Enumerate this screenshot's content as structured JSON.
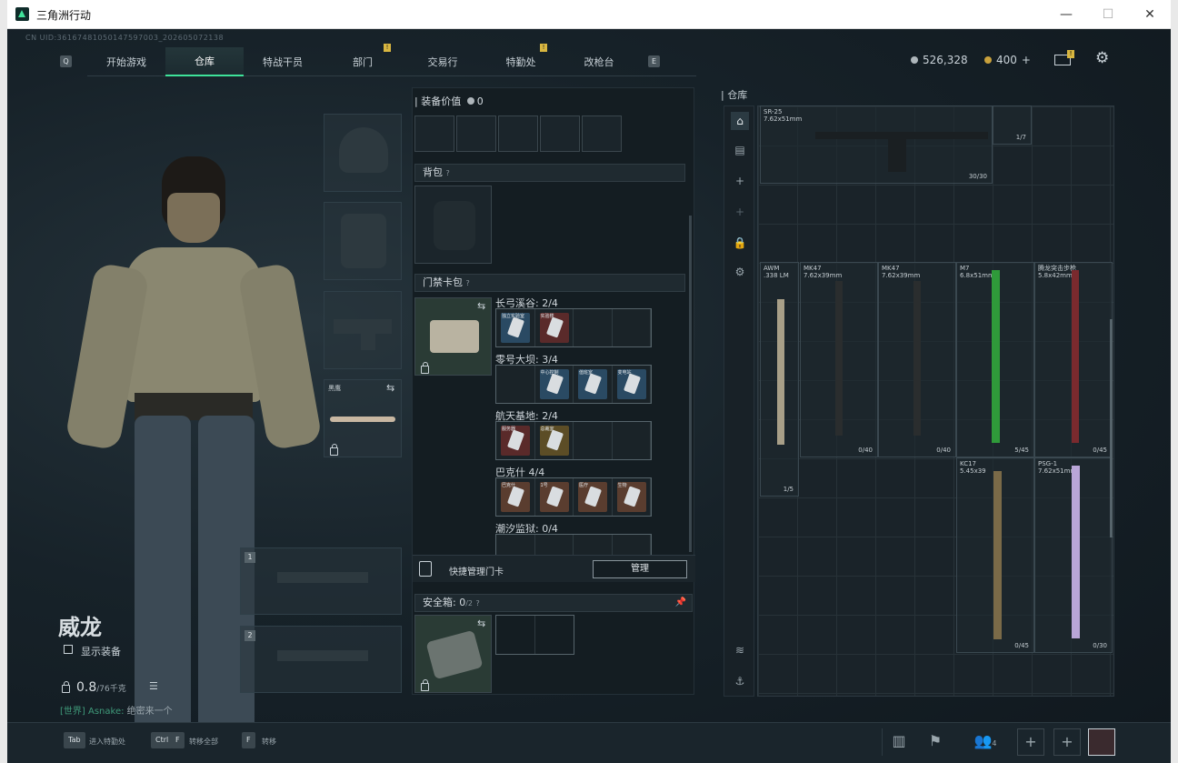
{
  "window": {
    "title": "三角洲行动"
  },
  "header": {
    "uid": "CN UID:3616748105014759700​3_202605072138",
    "tabs": [
      {
        "label": "开始游戏",
        "badge": ""
      },
      {
        "label": "仓库",
        "badge": ""
      },
      {
        "label": "特战干员",
        "badge": ""
      },
      {
        "label": "部门",
        "badge": "!"
      },
      {
        "label": "交易行",
        "badge": ""
      },
      {
        "label": "特勤处",
        "badge": "!"
      },
      {
        "label": "改枪台",
        "badge": ""
      }
    ],
    "key_left": "Q",
    "key_right": "E",
    "silver": "526,328",
    "gold": "400",
    "gold_plus": "+",
    "mail_badge": "!"
  },
  "character": {
    "name": "威龙",
    "show_gear_label": "显示装备",
    "weight": "0.8",
    "weight_max": "/76千克",
    "chat_channel": "[世界]",
    "chat_user": "Asnake:",
    "chat_msg": "绝密来一个",
    "weapon_slot_1": "1",
    "weapon_slot_2": "2",
    "melee_label": "黑鹰"
  },
  "middle": {
    "equip_value_label": "装备价值",
    "equip_value": "0",
    "backpack_label": "背包",
    "help": "?",
    "keycard_label": "门禁卡包",
    "maps": [
      {
        "name": "长弓溪谷: 2/4",
        "cards": [
          {
            "tag": "独立实验室",
            "color": "b"
          },
          {
            "tag": "实验楼",
            "color": "r"
          },
          {
            "tag": "",
            "color": ""
          },
          {
            "tag": "",
            "color": ""
          }
        ]
      },
      {
        "name": "零号大坝: 3/4",
        "cards": [
          {
            "tag": "",
            "color": ""
          },
          {
            "tag": "中心控制",
            "color": "b"
          },
          {
            "tag": "值班室",
            "color": "b"
          },
          {
            "tag": "变电站",
            "color": "b"
          }
        ]
      },
      {
        "name": "航天基地: 2/4",
        "cards": [
          {
            "tag": "服务器",
            "color": "r"
          },
          {
            "tag": "总裁室",
            "color": "g"
          },
          {
            "tag": "",
            "color": ""
          },
          {
            "tag": "",
            "color": ""
          }
        ]
      },
      {
        "name": "巴克什 4/4",
        "cards": [
          {
            "tag": "巴克什",
            "color": "o"
          },
          {
            "tag": "1号",
            "color": "o"
          },
          {
            "tag": "医疗",
            "color": "o"
          },
          {
            "tag": "生物",
            "color": "o"
          }
        ]
      },
      {
        "name": "潮汐监狱: 0/4",
        "cards": []
      }
    ],
    "quick_manage_label": "快捷管理门卡",
    "manage_button": "管理",
    "safebox_label": "安全箱:",
    "safebox_value": "0",
    "safebox_max": "/2"
  },
  "warehouse": {
    "title": "仓库",
    "weapons": [
      {
        "name": "SR-25",
        "cal": "7.62x51mm",
        "count": "30/30",
        "extra": "1/7"
      },
      {
        "name": "AWM",
        "cal": ".338 LM",
        "count": "1/5"
      },
      {
        "name": "MK47",
        "cal": "7.62x39mm",
        "count": "0/40"
      },
      {
        "name": "MK47",
        "cal": "7.62x39mm",
        "count": "0/40"
      },
      {
        "name": "M7",
        "cal": "6.8x51mm",
        "count": "5/45"
      },
      {
        "name": "腾龙突击步枪",
        "cal": "5.8x42mm",
        "count": "0/45"
      },
      {
        "name": "KC17",
        "cal": "5.45x39",
        "count": "0/45"
      },
      {
        "name": "PSG-1",
        "cal": "7.62x51mm",
        "count": "0/30"
      }
    ]
  },
  "bottom": {
    "tab_key": "Tab",
    "tab_label": "进入特勤处",
    "ctrl_key": "Ctrl",
    "f_key": "F",
    "ctrlf_label": "转移全部",
    "f_label": "转移",
    "friends": "4"
  }
}
